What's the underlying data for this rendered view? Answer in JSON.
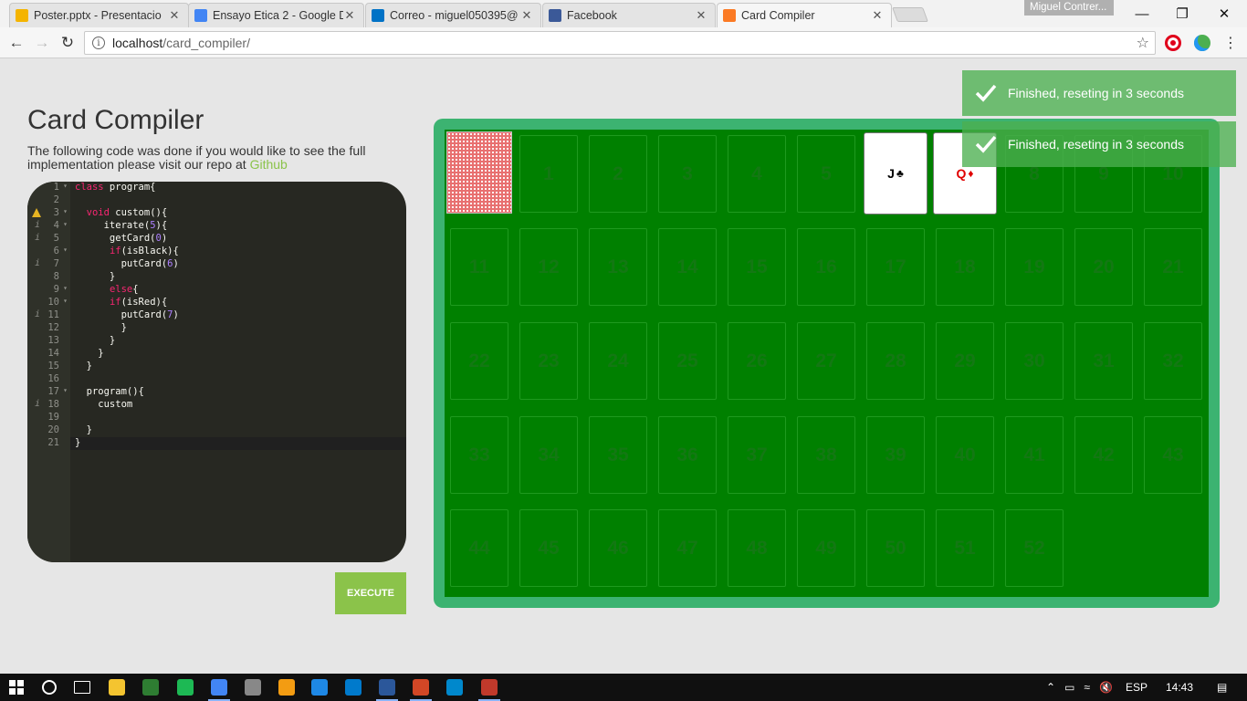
{
  "browser": {
    "tabs": [
      {
        "title": "Poster.pptx - Presentacio",
        "icon": "slides-icon",
        "color": "#f4b400"
      },
      {
        "title": "Ensayo Etica 2 - Google D",
        "icon": "docs-icon",
        "color": "#4285f4"
      },
      {
        "title": "Correo - miguel050395@",
        "icon": "outlook-icon",
        "color": "#0072c6"
      },
      {
        "title": "Facebook",
        "icon": "facebook-icon",
        "color": "#3b5998"
      },
      {
        "title": "Card Compiler",
        "icon": "xampp-icon",
        "color": "#fb7a24"
      }
    ],
    "profile_name": "Miguel Contrer...",
    "url_host": "localhost",
    "url_path": "/card_compiler/"
  },
  "page": {
    "title": "Card Compiler",
    "description": "The following code was done if you would like to see the full implementation please visit our repo at ",
    "link_text": "Github",
    "execute_label": "EXECUTE"
  },
  "editor": {
    "lines": [
      {
        "n": "1",
        "fold": true,
        "mark": "",
        "code": [
          [
            "kw",
            "class"
          ],
          [
            "t",
            " program{"
          ]
        ]
      },
      {
        "n": "2",
        "fold": false,
        "mark": "",
        "code": []
      },
      {
        "n": "3",
        "fold": true,
        "mark": "warn",
        "code": [
          [
            "t",
            "  "
          ],
          [
            "kw",
            "void"
          ],
          [
            "t",
            " custom(){"
          ]
        ]
      },
      {
        "n": "4",
        "fold": true,
        "mark": "i",
        "code": [
          [
            "t",
            "     iterate("
          ],
          [
            "nm",
            "5"
          ],
          [
            "t",
            "){"
          ]
        ]
      },
      {
        "n": "5",
        "fold": false,
        "mark": "i",
        "code": [
          [
            "t",
            "      getCard("
          ],
          [
            "nm",
            "0"
          ],
          [
            "t",
            ")"
          ]
        ]
      },
      {
        "n": "6",
        "fold": true,
        "mark": "",
        "code": [
          [
            "t",
            "      "
          ],
          [
            "kw",
            "if"
          ],
          [
            "t",
            "(isBlack){"
          ]
        ]
      },
      {
        "n": "7",
        "fold": false,
        "mark": "i",
        "code": [
          [
            "t",
            "        putCard("
          ],
          [
            "nm",
            "6"
          ],
          [
            "t",
            ")"
          ]
        ]
      },
      {
        "n": "8",
        "fold": false,
        "mark": "",
        "code": [
          [
            "t",
            "      }"
          ]
        ]
      },
      {
        "n": "9",
        "fold": true,
        "mark": "",
        "code": [
          [
            "t",
            "      "
          ],
          [
            "kw",
            "else"
          ],
          [
            "t",
            "{"
          ]
        ]
      },
      {
        "n": "10",
        "fold": true,
        "mark": "",
        "code": [
          [
            "t",
            "      "
          ],
          [
            "kw",
            "if"
          ],
          [
            "t",
            "(isRed){"
          ]
        ]
      },
      {
        "n": "11",
        "fold": false,
        "mark": "i",
        "code": [
          [
            "t",
            "        putCard("
          ],
          [
            "nm",
            "7"
          ],
          [
            "t",
            ")"
          ]
        ]
      },
      {
        "n": "12",
        "fold": false,
        "mark": "",
        "code": [
          [
            "t",
            "        }"
          ]
        ]
      },
      {
        "n": "13",
        "fold": false,
        "mark": "",
        "code": [
          [
            "t",
            "      }"
          ]
        ]
      },
      {
        "n": "14",
        "fold": false,
        "mark": "",
        "code": [
          [
            "t",
            "    }"
          ]
        ]
      },
      {
        "n": "15",
        "fold": false,
        "mark": "",
        "code": [
          [
            "t",
            "  }"
          ]
        ]
      },
      {
        "n": "16",
        "fold": false,
        "mark": "",
        "code": []
      },
      {
        "n": "17",
        "fold": true,
        "mark": "",
        "code": [
          [
            "t",
            "  program(){"
          ]
        ]
      },
      {
        "n": "18",
        "fold": false,
        "mark": "i",
        "code": [
          [
            "t",
            "    custom"
          ]
        ]
      },
      {
        "n": "19",
        "fold": false,
        "mark": "",
        "code": []
      },
      {
        "n": "20",
        "fold": false,
        "mark": "",
        "code": [
          [
            "t",
            "  }"
          ]
        ]
      },
      {
        "n": "21",
        "fold": false,
        "mark": "",
        "code": [
          [
            "t",
            "}"
          ]
        ]
      }
    ]
  },
  "board": {
    "slots": [
      "",
      "1",
      "2",
      "3",
      "4",
      "5",
      "6",
      "7",
      "8",
      "9",
      "10",
      "11",
      "12",
      "13",
      "14",
      "15",
      "16",
      "17",
      "18",
      "19",
      "20",
      "21",
      "22",
      "23",
      "24",
      "25",
      "26",
      "27",
      "28",
      "29",
      "30",
      "31",
      "32",
      "33",
      "34",
      "35",
      "36",
      "37",
      "38",
      "39",
      "40",
      "41",
      "42",
      "43",
      "44",
      "45",
      "46",
      "47",
      "48",
      "49",
      "50",
      "51",
      "52"
    ],
    "cards": [
      {
        "slot": 6,
        "rank": "J",
        "suit": "♣",
        "color": "#000000"
      },
      {
        "slot": 7,
        "rank": "Q",
        "suit": "♦",
        "color": "#e00000"
      }
    ],
    "deck_slot": 0
  },
  "notifications": [
    {
      "text": "Finished, reseting in 3 seconds"
    },
    {
      "text": "Finished, reseting in 3 seconds"
    }
  ],
  "taskbar": {
    "apps": [
      "file-explorer-icon",
      "winamp-icon",
      "spotify-icon",
      "chrome-icon",
      "app-icon",
      "app-icon",
      "powershell-icon",
      "vscode-icon",
      "word-icon",
      "powerpoint-icon",
      "telegram-icon",
      "app-icon"
    ],
    "language": "ESP",
    "time": "14:43"
  }
}
